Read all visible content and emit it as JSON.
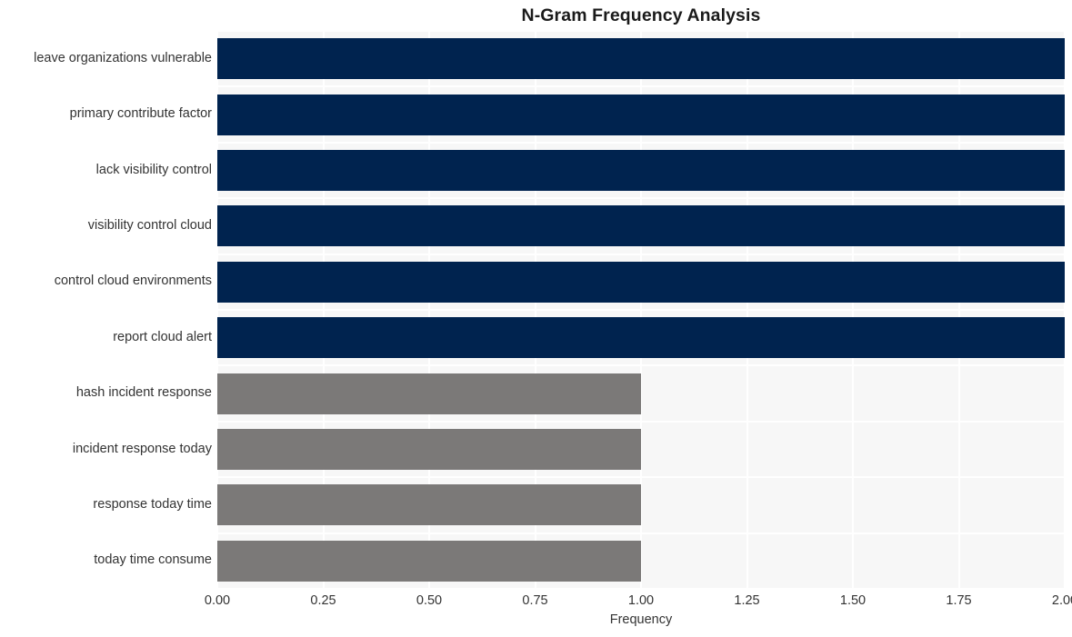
{
  "chart_data": {
    "type": "bar",
    "orientation": "horizontal",
    "title": "N-Gram Frequency Analysis",
    "xlabel": "Frequency",
    "ylabel": "",
    "xlim": [
      0,
      2
    ],
    "ylim": [
      0,
      10
    ],
    "grid": true,
    "legend": "none",
    "xticks": [
      "0.00",
      "0.25",
      "0.50",
      "0.75",
      "1.00",
      "1.25",
      "1.50",
      "1.75",
      "2.00"
    ],
    "xtick_values": [
      0,
      0.25,
      0.5,
      0.75,
      1.0,
      1.25,
      1.5,
      1.75,
      2.0
    ],
    "categories": [
      "leave organizations vulnerable",
      "primary contribute factor",
      "lack visibility control",
      "visibility control cloud",
      "control cloud environments",
      "report cloud alert",
      "hash incident response",
      "incident response today",
      "response today time",
      "today time consume"
    ],
    "values": [
      2,
      2,
      2,
      2,
      2,
      2,
      1,
      1,
      1,
      1
    ],
    "bar_colors": [
      "#00234f",
      "#00234f",
      "#00234f",
      "#00234f",
      "#00234f",
      "#00234f",
      "#7b7978",
      "#7b7978",
      "#7b7978",
      "#7b7978"
    ],
    "plot_background": "#f7f7f7",
    "gridline_color": "#ffffff",
    "figure_background": "#ffffff"
  }
}
